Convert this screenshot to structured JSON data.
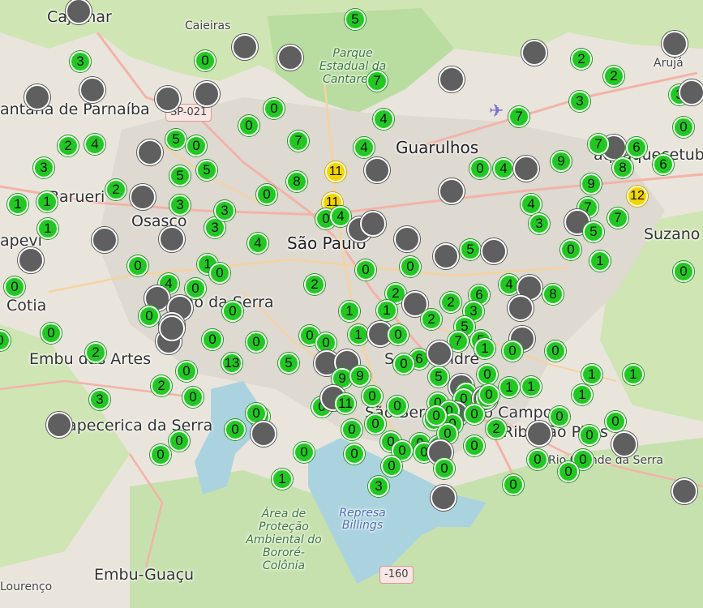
{
  "map": {
    "labels": [
      {
        "id": "cajamar",
        "text": "Cajamar",
        "cls": "l-town"
      },
      {
        "id": "caieiras",
        "text": "Caieiras",
        "cls": "l-small"
      },
      {
        "id": "parque-estadual",
        "text": "Parque Estadual da Cantareira",
        "cls": "l-park"
      },
      {
        "id": "aruja",
        "text": "Arujá",
        "cls": "l-small"
      },
      {
        "id": "santana-de-parnaiba",
        "text": "antana de Parnaíba",
        "cls": "l-town"
      },
      {
        "id": "guarulhos",
        "text": "Guarulhos",
        "cls": "l-city"
      },
      {
        "id": "quaquecetuba",
        "text": "aquaquecetuba",
        "cls": "l-town"
      },
      {
        "id": "barueri",
        "text": "Barueri",
        "cls": "l-town"
      },
      {
        "id": "osasco",
        "text": "Osasco",
        "cls": "l-town"
      },
      {
        "id": "sao-paulo",
        "text": "São Paulo",
        "cls": "l-city"
      },
      {
        "id": "itapevi",
        "text": "apevi",
        "cls": "l-town"
      },
      {
        "id": "suzano",
        "text": "Suzano",
        "cls": "l-town"
      },
      {
        "id": "cotia",
        "text": "Cotia",
        "cls": "l-town"
      },
      {
        "id": "taboao",
        "text": "Taboão da Serra",
        "cls": "l-town"
      },
      {
        "id": "embu-das-artes",
        "text": "Embu das Artes",
        "cls": "l-town"
      },
      {
        "id": "santo-andre",
        "text": "Santo André",
        "cls": "l-town"
      },
      {
        "id": "itapecerica",
        "text": "Itapecerica da Serra",
        "cls": "l-town"
      },
      {
        "id": "sao-bernardo",
        "text": "São Bernardo do Campo",
        "cls": "l-town"
      },
      {
        "id": "ribeirao-pires",
        "text": "Ribeirão Pires",
        "cls": "l-town"
      },
      {
        "id": "rio-grande-da-serra",
        "text": "Rio Grande da Serra",
        "cls": "l-small"
      },
      {
        "id": "area-protecao",
        "text": "Área de Proteção Ambiental do Bororé-Colônia",
        "cls": "l-park"
      },
      {
        "id": "represa-billings",
        "text": "Represa Billings",
        "cls": "l-water"
      },
      {
        "id": "embu-guacu",
        "text": "Embu-Guaçu",
        "cls": "l-town"
      },
      {
        "id": "lourenco",
        "text": "Lourenço",
        "cls": "l-small"
      }
    ],
    "shields": [
      {
        "id": "sp-021",
        "text": "SP-021"
      },
      {
        "id": "br-160",
        "text": "-160"
      }
    ],
    "markers": [
      {
        "t": "gray"
      },
      {
        "t": "green",
        "v": "5"
      },
      {
        "t": "green",
        "v": "3"
      },
      {
        "t": "green",
        "v": "0"
      },
      {
        "t": "gray"
      },
      {
        "t": "gray"
      },
      {
        "t": "green",
        "v": "7"
      },
      {
        "t": "gray"
      },
      {
        "t": "gray"
      },
      {
        "t": "green",
        "v": "2"
      },
      {
        "t": "green",
        "v": "2"
      },
      {
        "t": "gray"
      },
      {
        "t": "gray"
      },
      {
        "t": "gray"
      },
      {
        "t": "gray"
      },
      {
        "t": "gray"
      },
      {
        "t": "green",
        "v": "3"
      },
      {
        "t": "green",
        "v": "3"
      },
      {
        "t": "green",
        "v": "0"
      },
      {
        "t": "green",
        "v": "4"
      },
      {
        "t": "green",
        "v": "7"
      },
      {
        "t": "green",
        "v": "7"
      },
      {
        "t": "gray"
      },
      {
        "t": "green",
        "v": "0"
      },
      {
        "t": "green",
        "v": "2"
      },
      {
        "t": "green",
        "v": "4"
      },
      {
        "t": "green",
        "v": "5"
      },
      {
        "t": "green",
        "v": "0"
      },
      {
        "t": "gray"
      },
      {
        "t": "green",
        "v": "4"
      },
      {
        "t": "green",
        "v": "3"
      },
      {
        "t": "green",
        "v": "5"
      },
      {
        "t": "green",
        "v": "5"
      },
      {
        "t": "yellow",
        "v": "11"
      },
      {
        "t": "gray"
      },
      {
        "t": "green",
        "v": "0"
      },
      {
        "t": "green",
        "v": "4"
      },
      {
        "t": "gray"
      },
      {
        "t": "green",
        "v": "9"
      },
      {
        "t": "green",
        "v": "7"
      },
      {
        "t": "gray"
      },
      {
        "t": "green",
        "v": "6"
      },
      {
        "t": "green",
        "v": "8"
      },
      {
        "t": "green",
        "v": "6"
      },
      {
        "t": "green",
        "v": "2"
      },
      {
        "t": "green",
        "v": "8"
      },
      {
        "t": "green",
        "v": "0"
      },
      {
        "t": "gray"
      },
      {
        "t": "green",
        "v": "0"
      },
      {
        "t": "green",
        "v": "9"
      },
      {
        "t": "green",
        "v": "1"
      },
      {
        "t": "green",
        "v": "1"
      },
      {
        "t": "gray"
      },
      {
        "t": "green",
        "v": "3"
      },
      {
        "t": "yellow",
        "v": "11"
      },
      {
        "t": "green",
        "v": "4"
      },
      {
        "t": "yellow",
        "v": "12"
      },
      {
        "t": "green",
        "v": "7"
      },
      {
        "t": "green",
        "v": "1"
      },
      {
        "t": "green",
        "v": "3"
      },
      {
        "t": "green",
        "v": "3"
      },
      {
        "t": "green",
        "v": "0"
      },
      {
        "t": "green",
        "v": "4"
      },
      {
        "t": "gray"
      },
      {
        "t": "gray"
      },
      {
        "t": "green",
        "v": "3"
      },
      {
        "t": "gray"
      },
      {
        "t": "green",
        "v": "7"
      },
      {
        "t": "green",
        "v": "5"
      },
      {
        "t": "gray"
      },
      {
        "t": "gray"
      },
      {
        "t": "green",
        "v": "4"
      },
      {
        "t": "gray"
      },
      {
        "t": "gray"
      },
      {
        "t": "gray"
      },
      {
        "t": "green",
        "v": "5"
      },
      {
        "t": "gray"
      },
      {
        "t": "green",
        "v": "0"
      },
      {
        "t": "green",
        "v": "0"
      },
      {
        "t": "green",
        "v": "0"
      },
      {
        "t": "green",
        "v": "1"
      },
      {
        "t": "green",
        "v": "1"
      },
      {
        "t": "green",
        "v": "0"
      },
      {
        "t": "green",
        "v": "0"
      },
      {
        "t": "green",
        "v": "4"
      },
      {
        "t": "green",
        "v": "0"
      },
      {
        "t": "green",
        "v": "0"
      },
      {
        "t": "green",
        "v": "4"
      },
      {
        "t": "green",
        "v": "2"
      },
      {
        "t": "green",
        "v": "0"
      },
      {
        "t": "gray"
      },
      {
        "t": "green",
        "v": "8"
      },
      {
        "t": "green",
        "v": "2"
      },
      {
        "t": "green",
        "v": "6"
      },
      {
        "t": "gray"
      },
      {
        "t": "gray"
      },
      {
        "t": "green",
        "v": "0"
      },
      {
        "t": "gray"
      },
      {
        "t": "green",
        "v": "1"
      },
      {
        "t": "gray"
      },
      {
        "t": "green",
        "v": "0"
      },
      {
        "t": "green",
        "v": "2"
      },
      {
        "t": "green",
        "v": "2"
      },
      {
        "t": "green",
        "v": "3"
      },
      {
        "t": "gray"
      },
      {
        "t": "green",
        "v": "0"
      },
      {
        "t": "gray"
      },
      {
        "t": "green",
        "v": "0"
      },
      {
        "t": "green",
        "v": "0"
      },
      {
        "t": "green",
        "v": "0"
      },
      {
        "t": "green",
        "v": "0"
      },
      {
        "t": "green",
        "v": "1"
      },
      {
        "t": "gray"
      },
      {
        "t": "green",
        "v": "0"
      },
      {
        "t": "green",
        "v": "13"
      },
      {
        "t": "green",
        "v": "2"
      },
      {
        "t": "green",
        "v": "5"
      },
      {
        "t": "green",
        "v": "7"
      },
      {
        "t": "green",
        "v": "5"
      },
      {
        "t": "gray"
      },
      {
        "t": "green",
        "v": "0"
      },
      {
        "t": "green",
        "v": "1"
      },
      {
        "t": "green",
        "v": "5"
      },
      {
        "t": "green",
        "v": "6"
      },
      {
        "t": "gray"
      },
      {
        "t": "green",
        "v": "0"
      },
      {
        "t": "green",
        "v": "0"
      },
      {
        "t": "gray"
      },
      {
        "t": "green",
        "v": "0"
      },
      {
        "t": "gray"
      },
      {
        "t": "green",
        "v": "1"
      },
      {
        "t": "green",
        "v": "1"
      },
      {
        "t": "green",
        "v": "9"
      },
      {
        "t": "green",
        "v": "9"
      },
      {
        "t": "green",
        "v": "5"
      },
      {
        "t": "green",
        "v": "0"
      },
      {
        "t": "green",
        "v": "0"
      },
      {
        "t": "gray"
      },
      {
        "t": "gray"
      },
      {
        "t": "green",
        "v": "0"
      },
      {
        "t": "green",
        "v": "1"
      },
      {
        "t": "green",
        "v": "1"
      },
      {
        "t": "green",
        "v": "1"
      },
      {
        "t": "green",
        "v": "1"
      },
      {
        "t": "green",
        "v": "2"
      },
      {
        "t": "green",
        "v": "3"
      },
      {
        "t": "green",
        "v": "0"
      },
      {
        "t": "gray"
      },
      {
        "t": "green",
        "v": "0"
      },
      {
        "t": "green",
        "v": "0"
      },
      {
        "t": "green",
        "v": "0"
      },
      {
        "t": "green",
        "v": "0"
      },
      {
        "t": "green",
        "v": "0"
      },
      {
        "t": "gray"
      },
      {
        "t": "green",
        "v": "0"
      },
      {
        "t": "green",
        "v": "1"
      },
      {
        "t": "green",
        "v": "11"
      },
      {
        "t": "green",
        "v": "0"
      },
      {
        "t": "gray"
      },
      {
        "t": "green",
        "v": "0"
      },
      {
        "t": "green",
        "v": "0"
      },
      {
        "t": "gray"
      },
      {
        "t": "green",
        "v": "0"
      },
      {
        "t": "green",
        "v": "0"
      },
      {
        "t": "green",
        "v": "0"
      },
      {
        "t": "green",
        "v": "2"
      },
      {
        "t": "gray"
      },
      {
        "t": "green",
        "v": "0"
      },
      {
        "t": "green",
        "v": "0"
      },
      {
        "t": "green",
        "v": "0"
      },
      {
        "t": "green",
        "v": "0"
      },
      {
        "t": "green",
        "v": "0"
      },
      {
        "t": "green",
        "v": "0"
      },
      {
        "t": "green",
        "v": "0"
      },
      {
        "t": "green",
        "v": "0"
      },
      {
        "t": "green",
        "v": "0"
      },
      {
        "t": "gray"
      },
      {
        "t": "green",
        "v": "0"
      },
      {
        "t": "green",
        "v": "0"
      },
      {
        "t": "green",
        "v": "0"
      },
      {
        "t": "gray"
      },
      {
        "t": "green",
        "v": "0"
      },
      {
        "t": "green",
        "v": "0"
      },
      {
        "t": "green",
        "v": "0"
      },
      {
        "t": "green",
        "v": "0"
      },
      {
        "t": "green",
        "v": "0"
      },
      {
        "t": "green",
        "v": "0"
      },
      {
        "t": "green",
        "v": "1"
      },
      {
        "t": "green",
        "v": "3"
      },
      {
        "t": "green",
        "v": "0"
      },
      {
        "t": "gray"
      },
      {
        "t": "gray"
      },
      {
        "t": "green",
        "v": "0"
      },
      {
        "t": "green",
        "v": "0"
      },
      {
        "t": "gray"
      },
      {
        "t": "green",
        "v": "0"
      },
      {
        "t": "green",
        "v": "0"
      },
      {
        "t": "green",
        "v": "1"
      },
      {
        "t": "green",
        "v": "0"
      },
      {
        "t": "green",
        "v": "0"
      },
      {
        "t": "green",
        "v": "2"
      },
      {
        "t": "green",
        "v": "11"
      },
      {
        "t": "green",
        "v": "2"
      },
      {
        "t": "bold",
        "v": "2"
      }
    ]
  }
}
